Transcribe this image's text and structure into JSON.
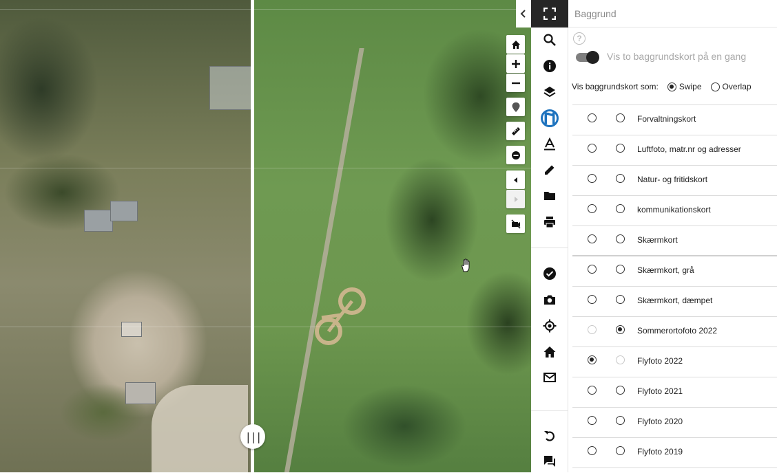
{
  "panel": {
    "title": "Baggrund",
    "help_symbol": "?",
    "toggle_label": "Vis to baggrundskort på en gang",
    "toggle_on": true,
    "mode_label": "Vis baggrundskort som:",
    "mode_options": [
      {
        "label": "Swipe",
        "selected": true
      },
      {
        "label": "Overlap",
        "selected": false
      }
    ],
    "layers": [
      {
        "label": "Forvaltningskort",
        "left_selected": false,
        "right_selected": false
      },
      {
        "label": "Luftfoto, matr.nr og adresser",
        "left_selected": false,
        "right_selected": false
      },
      {
        "label": "Natur- og fritidskort",
        "left_selected": false,
        "right_selected": false
      },
      {
        "label": "kommunikationskort",
        "left_selected": false,
        "right_selected": false
      },
      {
        "label": "Skærmkort",
        "left_selected": false,
        "right_selected": false
      },
      {
        "label": "Skærmkort, grå",
        "left_selected": false,
        "right_selected": false
      },
      {
        "label": "Skærmkort, dæmpet",
        "left_selected": false,
        "right_selected": false
      },
      {
        "label": "Sommerortofoto 2022",
        "left_selected": false,
        "right_selected": true,
        "left_disabled": true
      },
      {
        "label": "Flyfoto 2022",
        "left_selected": true,
        "right_selected": false,
        "right_disabled": true
      },
      {
        "label": "Flyfoto 2021",
        "left_selected": false,
        "right_selected": false
      },
      {
        "label": "Flyfoto 2020",
        "left_selected": false,
        "right_selected": false
      },
      {
        "label": "Flyfoto 2019",
        "left_selected": false,
        "right_selected": false
      }
    ]
  },
  "toolbar": {
    "buttons": [
      "fullscreen-icon",
      "search-icon",
      "info-icon",
      "layers-icon",
      "map-pin-icon",
      "text-icon",
      "pencil-icon",
      "folder-icon",
      "print-icon",
      "check-circle-icon",
      "camera-icon",
      "locate-icon",
      "home-icon",
      "mail-icon",
      "undo-icon",
      "chat-icon"
    ],
    "active": "background-icon",
    "active_color": "#1e73be"
  },
  "map": {
    "controls": [
      "home-icon",
      "zoom-in-icon",
      "zoom-out-icon",
      "marker-icon",
      "ruler-icon",
      "minus-circle-icon",
      "back-arrow-icon",
      "forward-arrow-icon",
      "stream-off-icon"
    ],
    "swipe_handle_symbol": "|||",
    "collapse_symbol": "‹"
  }
}
